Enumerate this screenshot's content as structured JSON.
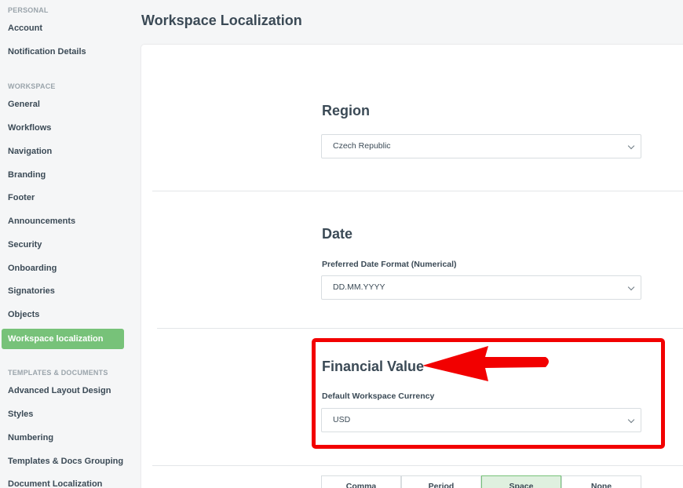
{
  "sidebar": {
    "sections": {
      "personal": "PERSONAL",
      "workspace": "WORKSPACE",
      "templates": "TEMPLATES & DOCUMENTS"
    },
    "personal_items": [
      "Account",
      "Notification Details"
    ],
    "workspace_items": [
      "General",
      "Workflows",
      "Navigation",
      "Branding",
      "Footer",
      "Announcements",
      "Security",
      "Onboarding",
      "Signatories",
      "Objects",
      "Workspace localization"
    ],
    "templates_items": [
      "Advanced Layout Design",
      "Styles",
      "Numbering",
      "Templates & Docs Grouping",
      "Document Localization"
    ],
    "active_item": "Workspace localization"
  },
  "page": {
    "title": "Workspace Localization"
  },
  "region": {
    "title": "Region",
    "value": "Czech Republic"
  },
  "date": {
    "title": "Date",
    "label": "Preferred Date Format (Numerical)",
    "value": "DD.MM.YYYY"
  },
  "financial": {
    "title": "Financial Value",
    "label": "Default Workspace Currency",
    "value": "USD"
  },
  "separator": {
    "options": [
      "Comma",
      "Period",
      "Space",
      "None"
    ],
    "selected": "Space"
  },
  "colors": {
    "accent": "#77c279",
    "annotation": "#f20000",
    "text": "#3b4a56"
  }
}
